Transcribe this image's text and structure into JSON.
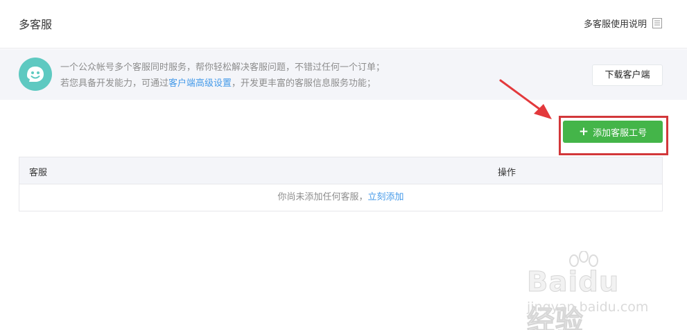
{
  "header": {
    "title": "多客服",
    "help_label": "多客服使用说明"
  },
  "notice": {
    "line1": "一个公众帐号多个客服同时服务，帮你轻松解决客服问题，不错过任何一个订单；",
    "line2_prefix": "若您具备开发能力，可通过",
    "line2_link": "客户端高级设置",
    "line2_suffix": "，开发更丰富的客服信息服务功能；",
    "download_label": "下载客户端"
  },
  "toolbar": {
    "add_label": "添加客服工号",
    "add_icon": "plus-icon"
  },
  "table": {
    "columns": [
      "客服",
      "操作"
    ],
    "empty_text": "你尚未添加任何客服，",
    "empty_link": "立刻添加"
  },
  "watermark": {
    "main": "Baidu经验",
    "sub": "jingyan.baidu.com"
  },
  "colors": {
    "accent_green": "#44b549",
    "link_blue": "#459ae9",
    "annotation_red": "#d2373a",
    "icon_teal": "#5ec9c1"
  }
}
